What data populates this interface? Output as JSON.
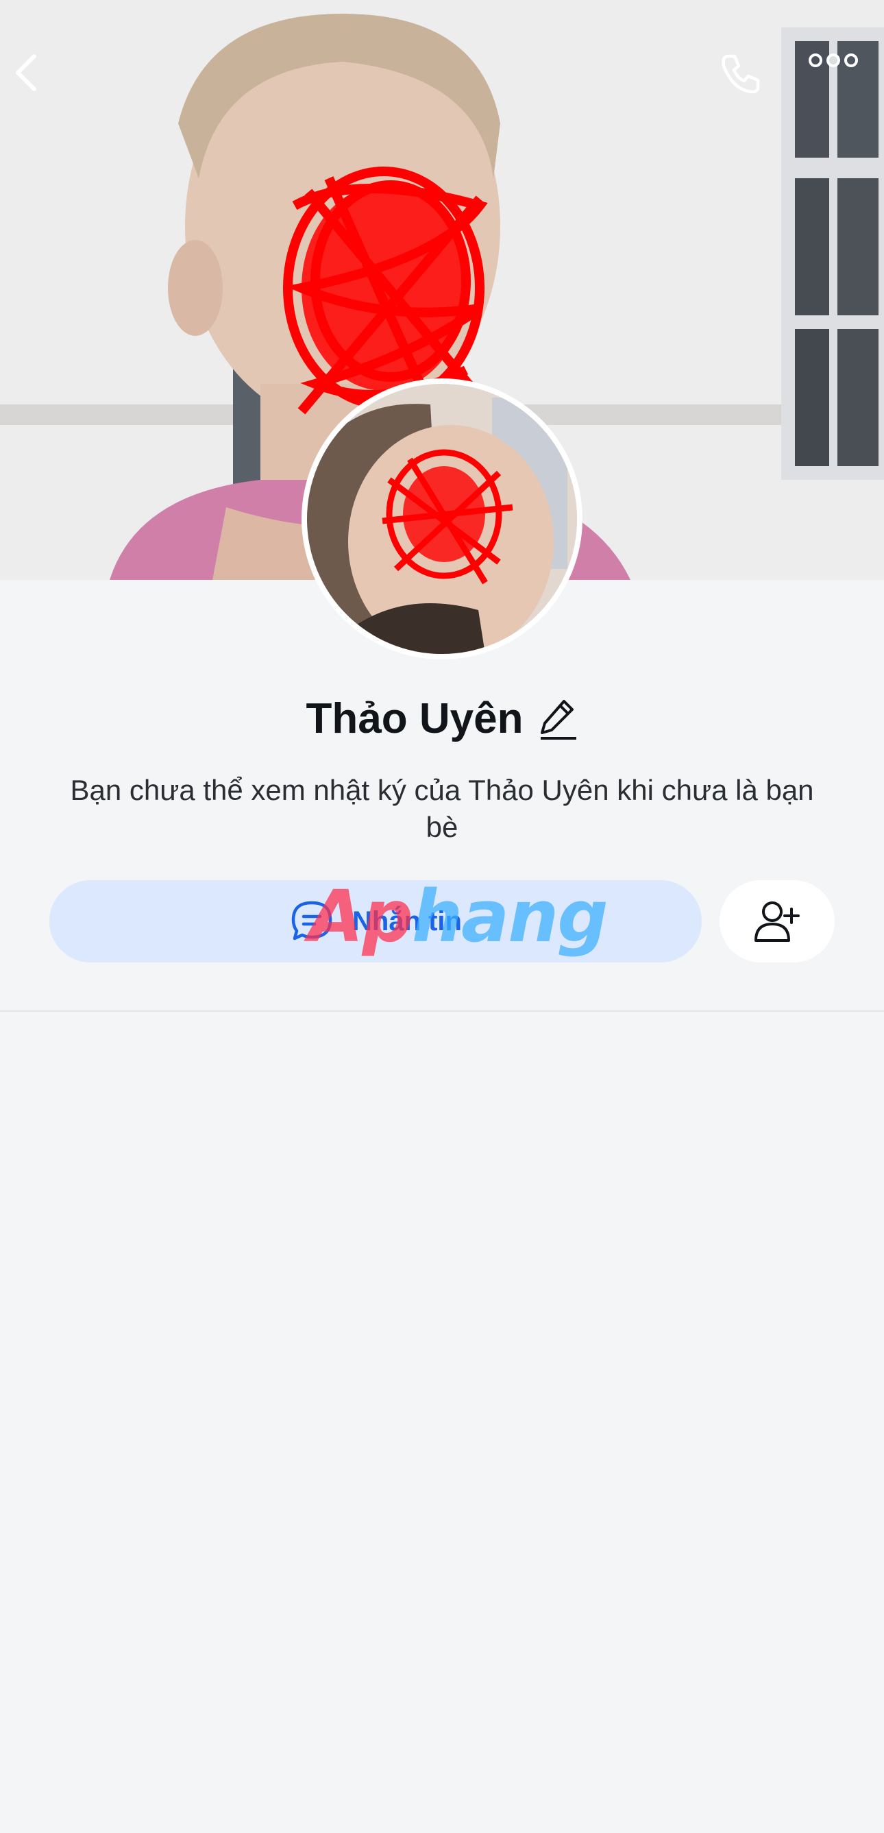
{
  "profile": {
    "name": "Thảo Uyên",
    "info_message": "Bạn chưa thể xem nhật ký của Thảo Uyên khi chưa là bạn bè"
  },
  "actions": {
    "message_label": "Nhắn tin",
    "watermark_part1": "Ap",
    "watermark_part2": "hang"
  },
  "icons": {
    "back": "chevron-left-icon",
    "call": "phone-icon",
    "more": "more-dots-icon",
    "edit": "pencil-icon",
    "message": "chat-bubble-icon",
    "add_friend": "add-user-icon"
  },
  "colors": {
    "accent": "#1b63e6",
    "message_button_bg": "#dce8fd",
    "page_bg": "#f3f5f7",
    "redaction": "#ff0000"
  }
}
